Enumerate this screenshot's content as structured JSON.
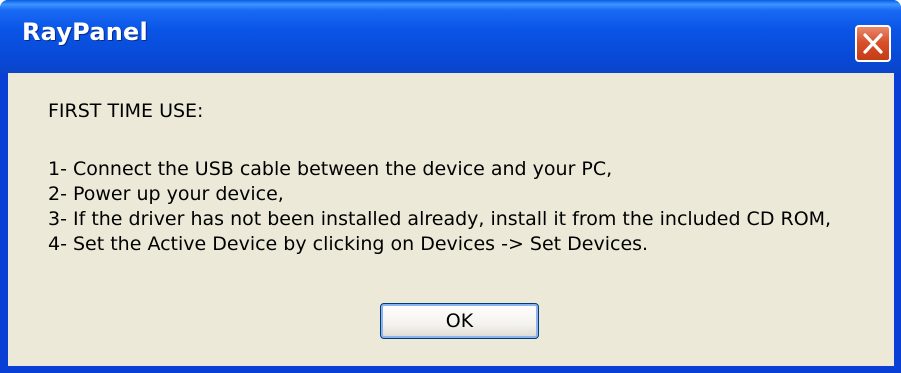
{
  "window": {
    "title": "RayPanel",
    "close_icon": "close-icon"
  },
  "message": {
    "heading": "FIRST TIME USE:",
    "steps": [
      "1- Connect the USB cable between the device and your PC,",
      "2- Power up your device,",
      "3- If the driver has not been installed already, install it from the included CD ROM,",
      "4- Set the Active Device by clicking on Devices -> Set Devices."
    ]
  },
  "buttons": {
    "ok_label": "OK"
  },
  "colors": {
    "titlebar": "#0a55e6",
    "client_background": "#ece9d8",
    "close_button": "#d9502a"
  }
}
